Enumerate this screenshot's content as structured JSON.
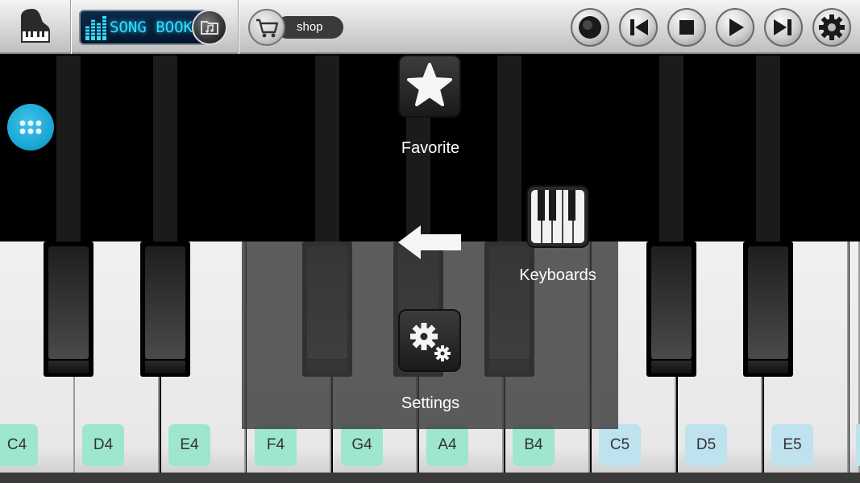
{
  "toolbar": {
    "songbook_label": "SONG BOOK",
    "shop_label": "shop",
    "icons": [
      "grand-piano-icon",
      "equalizer-icon",
      "music-folder-icon",
      "cart-icon",
      "record-icon",
      "previous-icon",
      "stop-icon",
      "play-icon",
      "next-icon",
      "gear-icon"
    ]
  },
  "menu": {
    "favorite_label": "Favorite",
    "keyboards_label": "Keyboards",
    "settings_label": "Settings"
  },
  "notes": [
    {
      "label": "C4",
      "octave": 4
    },
    {
      "label": "D4",
      "octave": 4
    },
    {
      "label": "E4",
      "octave": 4
    },
    {
      "label": "F4",
      "octave": 4
    },
    {
      "label": "G4",
      "octave": 4
    },
    {
      "label": "A4",
      "octave": 4
    },
    {
      "label": "B4",
      "octave": 4
    },
    {
      "label": "C5",
      "octave": 5
    },
    {
      "label": "D5",
      "octave": 5
    },
    {
      "label": "E5",
      "octave": 5
    }
  ],
  "colors": {
    "octave4_note_bg": "#9ee6cc",
    "octave5_note_bg": "#bfe2ef",
    "lcd_text": "#33e0ff",
    "menu_button": "#1aa5d4"
  }
}
